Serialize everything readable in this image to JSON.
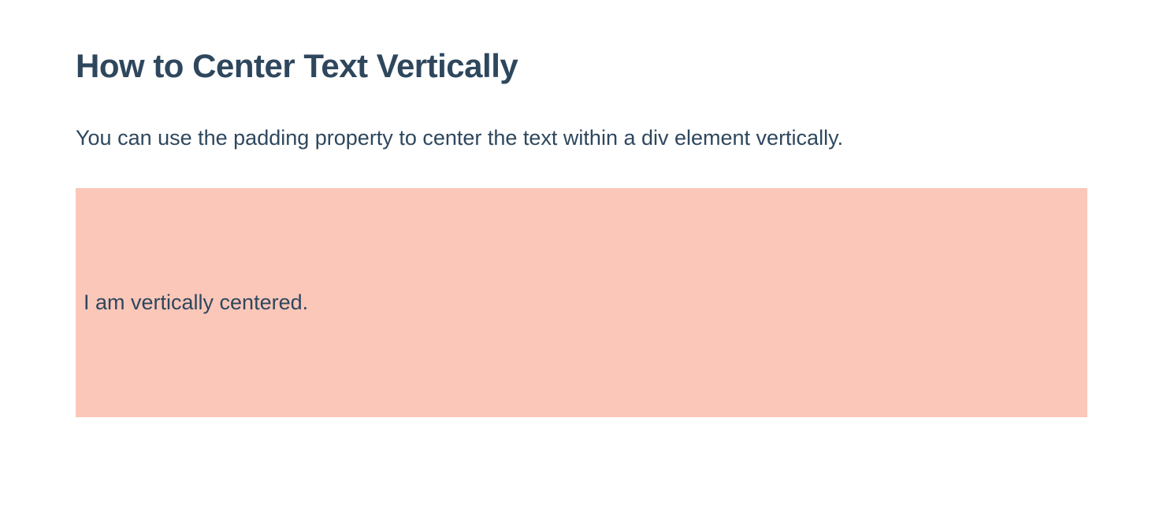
{
  "heading": "How to Center Text Vertically",
  "description": "You can use the padding property to center the text within a div element vertically.",
  "demo": {
    "text": "I am vertically centered."
  }
}
